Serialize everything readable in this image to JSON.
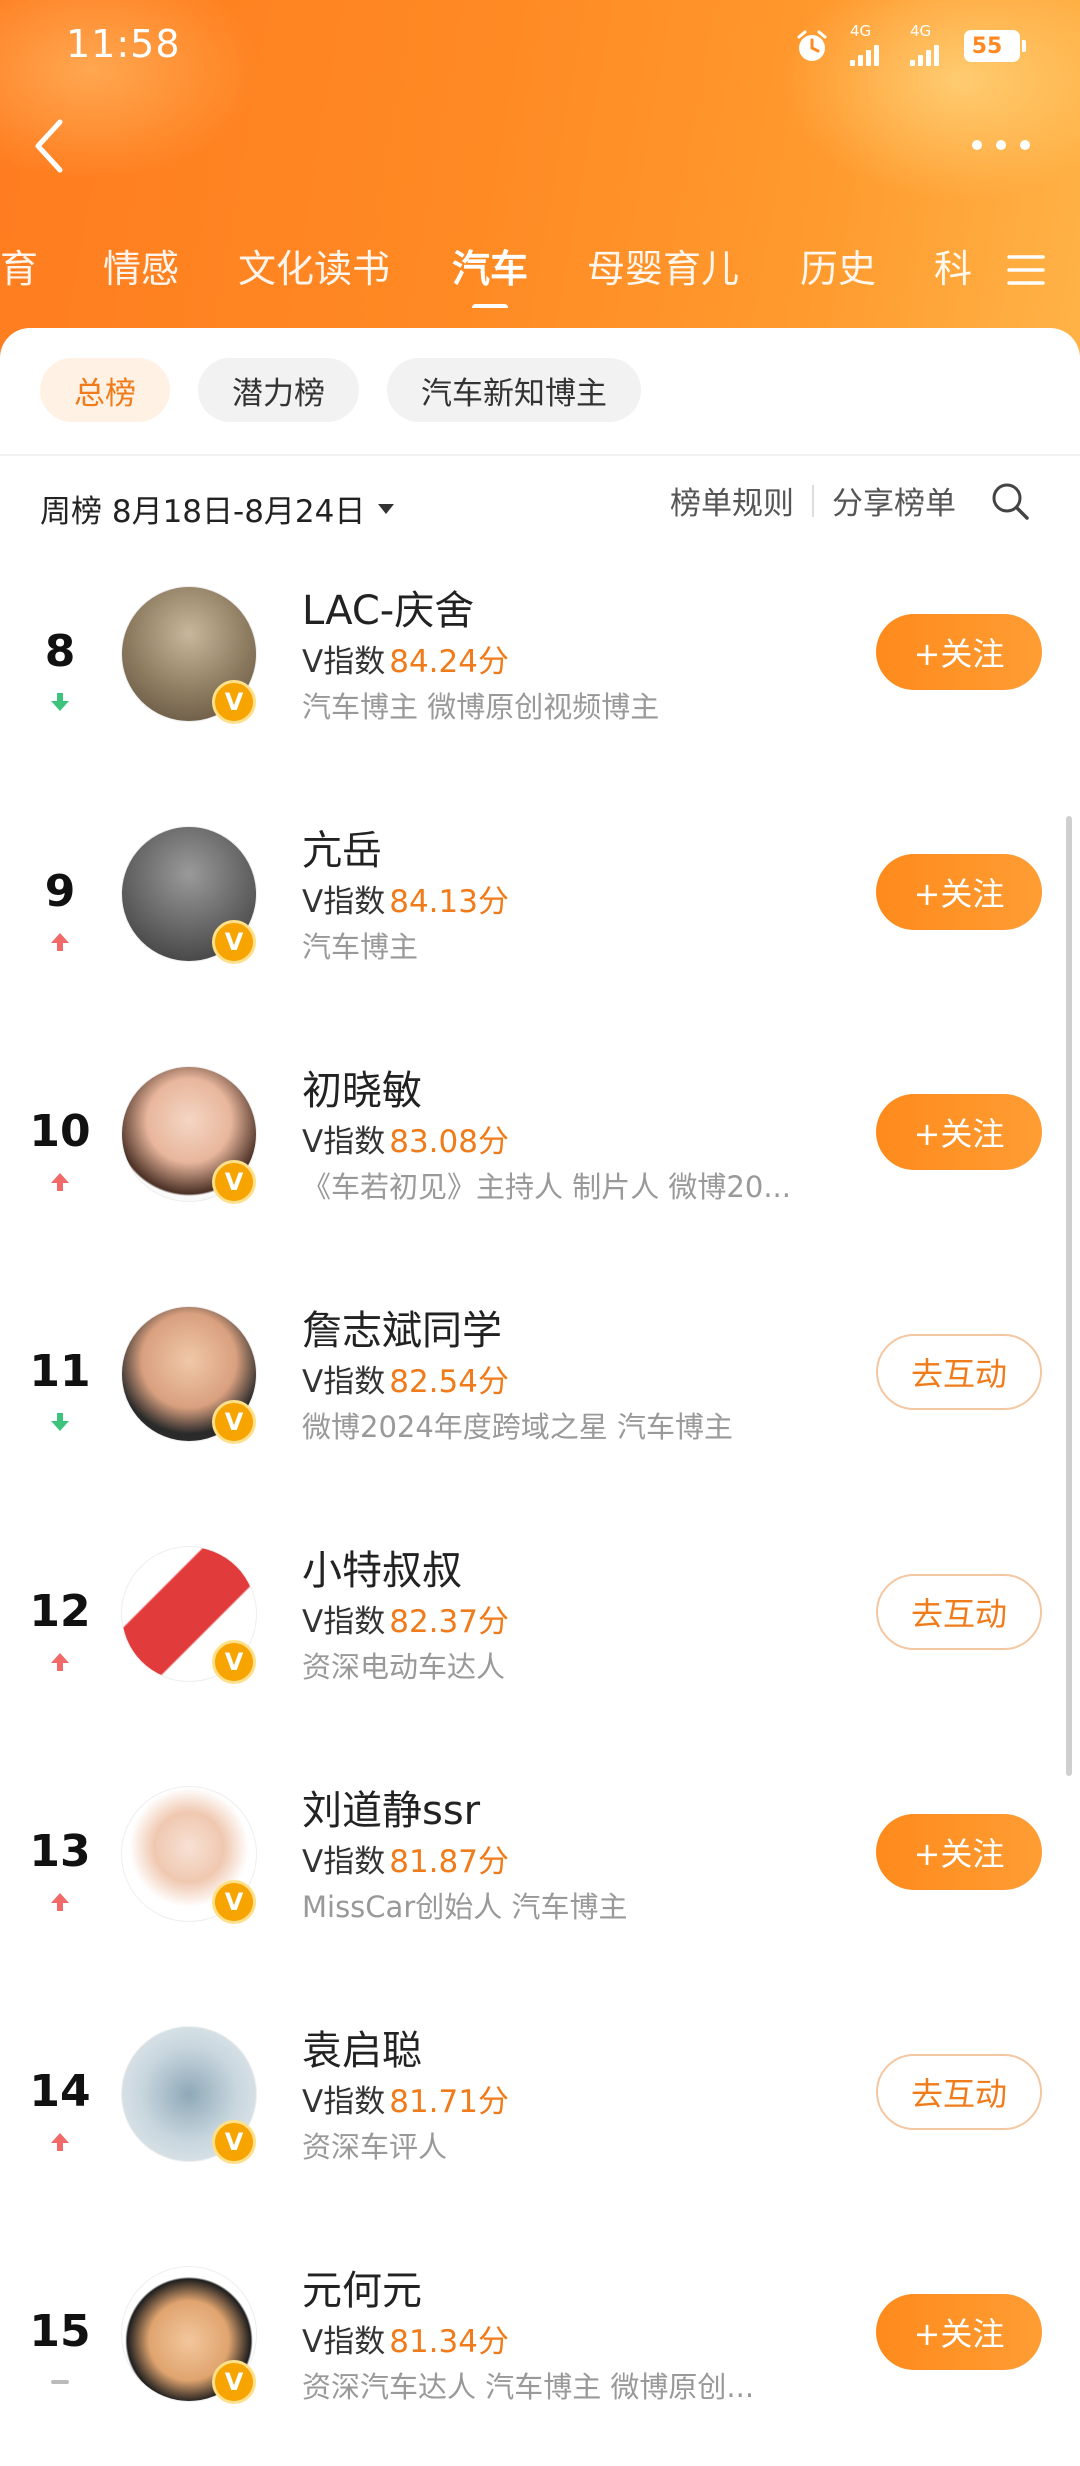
{
  "status_bar": {
    "time": "11:58",
    "network_1": "4G",
    "network_2": "4G",
    "battery": "55"
  },
  "nav": {
    "categories": [
      "教育",
      "情感",
      "文化读书",
      "汽车",
      "母婴育儿",
      "历史",
      "科"
    ],
    "active_category": "汽车"
  },
  "sub_tabs": [
    "总榜",
    "潜力榜",
    "汽车新知博主"
  ],
  "period": {
    "label": "周榜 8月18日-8月24日"
  },
  "tools": {
    "rules": "榜单规则",
    "share": "分享榜单"
  },
  "list": [
    {
      "rank": "8",
      "trend": "down",
      "name": "LAC-庆舍",
      "v_label": "V指数",
      "score": "84.24分",
      "desc": "汽车博主 微博原创视频博主",
      "action": "+关注",
      "action_type": "follow"
    },
    {
      "rank": "9",
      "trend": "up",
      "name": "亢岳",
      "v_label": "V指数",
      "score": "84.13分",
      "desc": "汽车博主",
      "action": "+关注",
      "action_type": "follow"
    },
    {
      "rank": "10",
      "trend": "up",
      "name": "初晓敏",
      "v_label": "V指数",
      "score": "83.08分",
      "desc": "《车若初见》主持人 制片人 微博20...",
      "action": "+关注",
      "action_type": "follow"
    },
    {
      "rank": "11",
      "trend": "down",
      "name": "詹志斌同学",
      "v_label": "V指数",
      "score": "82.54分",
      "desc": "微博2024年度跨域之星 汽车博主",
      "action": "去互动",
      "action_type": "interact"
    },
    {
      "rank": "12",
      "trend": "up",
      "name": "小特叔叔",
      "v_label": "V指数",
      "score": "82.37分",
      "desc": "资深电动车达人",
      "action": "去互动",
      "action_type": "interact"
    },
    {
      "rank": "13",
      "trend": "up",
      "name": "刘道静ssr",
      "v_label": "V指数",
      "score": "81.87分",
      "desc": "MissCar创始人 汽车博主",
      "action": "+关注",
      "action_type": "follow"
    },
    {
      "rank": "14",
      "trend": "up",
      "name": "袁启聪",
      "v_label": "V指数",
      "score": "81.71分",
      "desc": "资深车评人",
      "action": "去互动",
      "action_type": "interact"
    },
    {
      "rank": "15",
      "trend": "same",
      "name": "元何元",
      "v_label": "V指数",
      "score": "81.34分",
      "desc": "资深汽车达人 汽车博主 微博原创...",
      "action": "+关注",
      "action_type": "follow"
    }
  ],
  "colors": {
    "accent": "#f07b1a",
    "header_orange": "#ff8a24",
    "trend_up": "#f06a6a",
    "trend_down": "#3cc47c"
  }
}
